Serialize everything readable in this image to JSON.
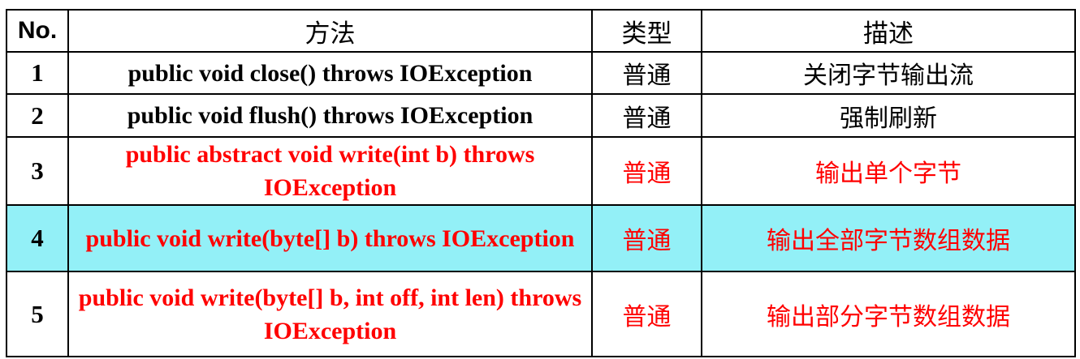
{
  "header": {
    "no": "No.",
    "method": "方法",
    "type": "类型",
    "desc": "描述"
  },
  "rows": [
    {
      "no": "1",
      "method": "public void close() throws IOException",
      "type": "普通",
      "desc": "关闭字节输出流",
      "color": "#000000"
    },
    {
      "no": "2",
      "method": "public void flush() throws IOException",
      "type": "普通",
      "desc": "强制刷新",
      "color": "#000000"
    },
    {
      "no": "3",
      "method": "public abstract void write(int b) throws IOException",
      "type": "普通",
      "desc": "输出单个字节",
      "color": "#ff0000"
    },
    {
      "no": "4",
      "method": "public void write(byte[] b) throws IOException",
      "type": "普通",
      "desc": "输出全部字节数组数据",
      "color": "#ff0000",
      "highlight": "#93f0f7"
    },
    {
      "no": "5",
      "method": "public void write(byte[] b, int off, int len) throws IOException",
      "type": "普通",
      "desc": "输出部分字节数组数据",
      "color": "#ff0000"
    }
  ]
}
